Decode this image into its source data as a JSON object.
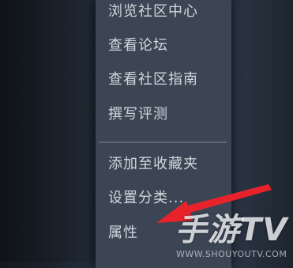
{
  "context_menu": {
    "items": [
      {
        "label": "浏览社区中心"
      },
      {
        "label": "查看论坛"
      },
      {
        "label": "查看社区指南"
      },
      {
        "label": "撰写评测"
      },
      {
        "label": "添加至收藏夹"
      },
      {
        "label": "设置分类..."
      },
      {
        "label": "属性"
      }
    ]
  },
  "annotation": {
    "arrow_color": "#e8222b",
    "icon": "red-arrow-icon"
  },
  "watermark": {
    "logo": "手游TV",
    "url": "WWW.SHOUYOUTV.COM"
  },
  "colors": {
    "menu_background": "#3c4553",
    "menu_text": "#d3d8de"
  }
}
